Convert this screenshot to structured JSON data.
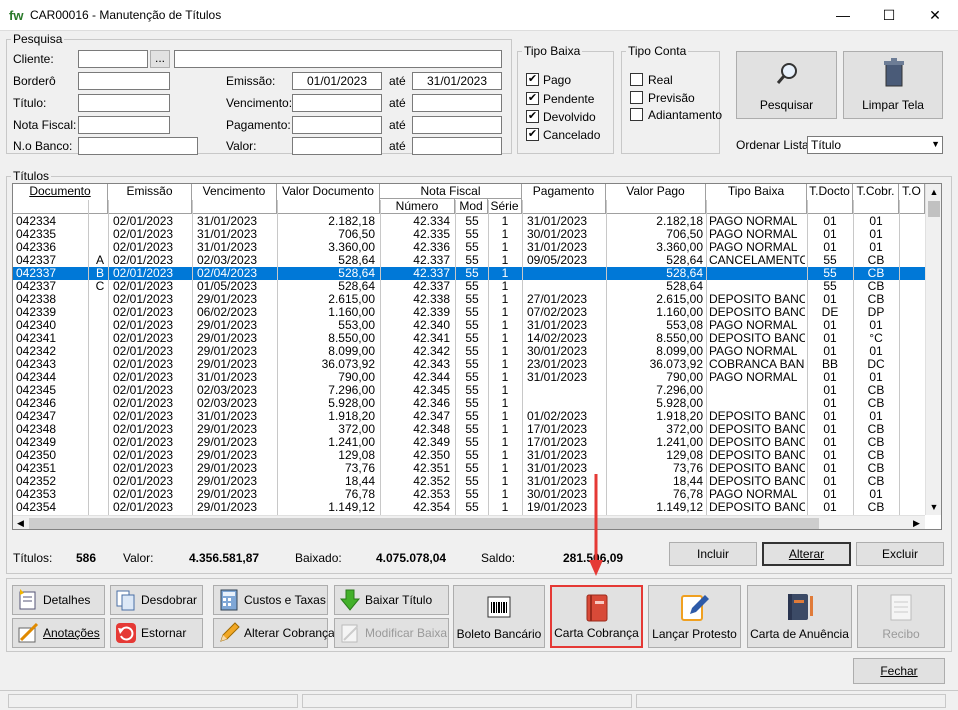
{
  "window": {
    "app_icon": "fw",
    "title": "CAR00016 - Manutenção de Títulos",
    "minimize": "—",
    "maximize": "☐",
    "close": "✕"
  },
  "search": {
    "group_label": "Pesquisa",
    "cliente_label": "Cliente:",
    "cliente_btn": "...",
    "bordero_label": "Borderô",
    "titulo_label": "Título:",
    "nota_fiscal_label": "Nota Fiscal:",
    "nobanco_label": "N.o Banco:",
    "emissao_label": "Emissão:",
    "emissao_from": "01/01/2023",
    "ate1": "até",
    "emissao_to": "31/01/2023",
    "vencimento_label": "Vencimento:",
    "ate2": "até",
    "pagamento_label": "Pagamento:",
    "ate3": "até",
    "valor_label": "Valor:",
    "ate4": "até"
  },
  "tipo_baixa": {
    "label": "Tipo Baixa",
    "options": [
      {
        "label": "Pago",
        "checked": true
      },
      {
        "label": "Pendente",
        "checked": true
      },
      {
        "label": "Devolvido",
        "checked": true
      },
      {
        "label": "Cancelado",
        "checked": true
      }
    ]
  },
  "tipo_conta": {
    "label": "Tipo Conta",
    "options": [
      {
        "label": "Real",
        "checked": false
      },
      {
        "label": "Previsão",
        "checked": false
      },
      {
        "label": "Adiantamento",
        "checked": false
      }
    ]
  },
  "buttons": {
    "pesquisar": "Pesquisar",
    "limpar": "Limpar Tela",
    "ordenar_label": "Ordenar Lista:",
    "ordenar_value": "Título"
  },
  "titulos": {
    "group_label": "Títulos",
    "headers": {
      "documento": "Documento",
      "emissao": "Emissão",
      "vencimento": "Vencimento",
      "valor_documento": "Valor Documento",
      "nota_fiscal": "Nota Fiscal",
      "numero": "Número",
      "mod": "Mod",
      "serie": "Série",
      "pagamento": "Pagamento",
      "valor_pago": "Valor Pago",
      "tipo_baixa": "Tipo Baixa",
      "t_docto": "T.Docto",
      "t_cobr": "T.Cobr.",
      "t_o": "T.O"
    },
    "rows": [
      [
        "042334",
        "",
        "02/01/2023",
        "31/01/2023",
        "2.182,18",
        "42.334",
        "55",
        "1",
        "31/01/2023",
        "2.182,18",
        "PAGO NORMAL",
        "01",
        "01"
      ],
      [
        "042335",
        "",
        "02/01/2023",
        "31/01/2023",
        "706,50",
        "42.335",
        "55",
        "1",
        "30/01/2023",
        "706,50",
        "PAGO NORMAL",
        "01",
        "01"
      ],
      [
        "042336",
        "",
        "02/01/2023",
        "31/01/2023",
        "3.360,00",
        "42.336",
        "55",
        "1",
        "31/01/2023",
        "3.360,00",
        "PAGO NORMAL",
        "01",
        "01"
      ],
      [
        "042337",
        "A",
        "02/01/2023",
        "02/03/2023",
        "528,64",
        "42.337",
        "55",
        "1",
        "09/05/2023",
        "528,64",
        "CANCELAMENTO",
        "55",
        "CB"
      ],
      [
        "042337",
        "B",
        "02/01/2023",
        "02/04/2023",
        "528,64",
        "42.337",
        "55",
        "1",
        "",
        "528,64",
        "",
        "55",
        "CB"
      ],
      [
        "042337",
        "C",
        "02/01/2023",
        "01/05/2023",
        "528,64",
        "42.337",
        "55",
        "1",
        "",
        "528,64",
        "",
        "55",
        "CB"
      ],
      [
        "042338",
        "",
        "02/01/2023",
        "29/01/2023",
        "2.615,00",
        "42.338",
        "55",
        "1",
        "27/01/2023",
        "2.615,00",
        "DEPOSITO BANCA",
        "01",
        "CB"
      ],
      [
        "042339",
        "",
        "02/01/2023",
        "06/02/2023",
        "1.160,00",
        "42.339",
        "55",
        "1",
        "07/02/2023",
        "1.160,00",
        "DEPOSITO BANCA",
        "DE",
        "DP"
      ],
      [
        "042340",
        "",
        "02/01/2023",
        "29/01/2023",
        "553,00",
        "42.340",
        "55",
        "1",
        "31/01/2023",
        "553,08",
        "PAGO NORMAL",
        "01",
        "01"
      ],
      [
        "042341",
        "",
        "02/01/2023",
        "29/01/2023",
        "8.550,00",
        "42.341",
        "55",
        "1",
        "14/02/2023",
        "8.550,00",
        "DEPOSITO BANCA",
        "01",
        "°C"
      ],
      [
        "042342",
        "",
        "02/01/2023",
        "29/01/2023",
        "8.099,00",
        "42.342",
        "55",
        "1",
        "30/01/2023",
        "8.099,00",
        "PAGO NORMAL",
        "01",
        "01"
      ],
      [
        "042343",
        "",
        "02/01/2023",
        "29/01/2023",
        "36.073,92",
        "42.343",
        "55",
        "1",
        "23/01/2023",
        "36.073,92",
        "COBRANCA BANCA",
        "BB",
        "DC"
      ],
      [
        "042344",
        "",
        "02/01/2023",
        "31/01/2023",
        "790,00",
        "42.344",
        "55",
        "1",
        "31/01/2023",
        "790,00",
        "PAGO NORMAL",
        "01",
        "01"
      ],
      [
        "042345",
        "",
        "02/01/2023",
        "02/03/2023",
        "7.296,00",
        "42.345",
        "55",
        "1",
        "",
        "7.296,00",
        "",
        "01",
        "CB"
      ],
      [
        "042346",
        "",
        "02/01/2023",
        "02/03/2023",
        "5.928,00",
        "42.346",
        "55",
        "1",
        "",
        "5.928,00",
        "",
        "01",
        "CB"
      ],
      [
        "042347",
        "",
        "02/01/2023",
        "31/01/2023",
        "1.918,20",
        "42.347",
        "55",
        "1",
        "01/02/2023",
        "1.918,20",
        "DEPOSITO BANCA",
        "01",
        "01"
      ],
      [
        "042348",
        "",
        "02/01/2023",
        "29/01/2023",
        "372,00",
        "42.348",
        "55",
        "1",
        "17/01/2023",
        "372,00",
        "DEPOSITO BANCA",
        "01",
        "CB"
      ],
      [
        "042349",
        "",
        "02/01/2023",
        "29/01/2023",
        "1.241,00",
        "42.349",
        "55",
        "1",
        "17/01/2023",
        "1.241,00",
        "DEPOSITO BANCA",
        "01",
        "CB"
      ],
      [
        "042350",
        "",
        "02/01/2023",
        "29/01/2023",
        "129,08",
        "42.350",
        "55",
        "1",
        "31/01/2023",
        "129,08",
        "DEPOSITO BANCA",
        "01",
        "CB"
      ],
      [
        "042351",
        "",
        "02/01/2023",
        "29/01/2023",
        "73,76",
        "42.351",
        "55",
        "1",
        "31/01/2023",
        "73,76",
        "DEPOSITO BANCA",
        "01",
        "CB"
      ],
      [
        "042352",
        "",
        "02/01/2023",
        "29/01/2023",
        "18,44",
        "42.352",
        "55",
        "1",
        "31/01/2023",
        "18,44",
        "DEPOSITO BANCA",
        "01",
        "CB"
      ],
      [
        "042353",
        "",
        "02/01/2023",
        "29/01/2023",
        "76,78",
        "42.353",
        "55",
        "1",
        "30/01/2023",
        "76,78",
        "PAGO NORMAL",
        "01",
        "01"
      ],
      [
        "042354",
        "",
        "02/01/2023",
        "29/01/2023",
        "1.149,12",
        "42.354",
        "55",
        "1",
        "19/01/2023",
        "1.149,12",
        "DEPOSITO BANCA",
        "01",
        "CB"
      ]
    ],
    "selected_row": 4
  },
  "totals": {
    "titulos_label": "Títulos:",
    "titulos": "586",
    "valor_label": "Valor:",
    "valor": "4.356.581,87",
    "baixado_label": "Baixado:",
    "baixado": "4.075.078,04",
    "saldo_label": "Saldo:",
    "saldo": "281.506,09"
  },
  "grid_buttons": {
    "incluir": "Incluir",
    "alterar": "Alterar",
    "excluir": "Excluir"
  },
  "actions": {
    "detalhes": "Detalhes",
    "desdobrar": "Desdobrar",
    "custos": "Custos e Taxas",
    "baixar": "Baixar Título",
    "anotacoes": "Anotações",
    "estornar": "Estornar",
    "alterar_cobranca": "Alterar Cobrança",
    "modificar_baixa": "Modificar Baixa",
    "boleto": "Boleto Bancário",
    "carta_cobranca": "Carta Cobrança",
    "lancar_protesto": "Lançar Protesto",
    "carta_anuencia": "Carta de Anuência",
    "recibo": "Recibo"
  },
  "footer": {
    "fechar": "Fechar"
  },
  "colors": {
    "selection": "#0078d7",
    "highlight": "#e53935"
  }
}
